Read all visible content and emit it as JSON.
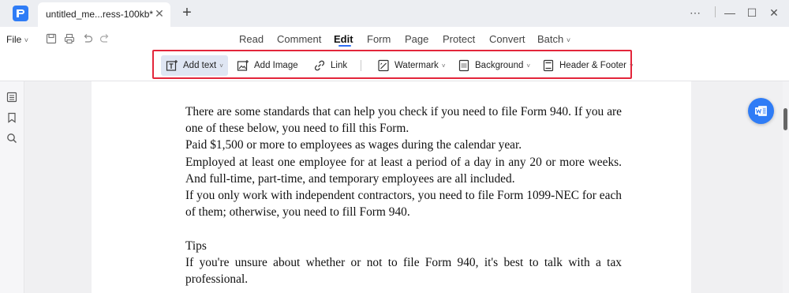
{
  "window": {
    "tab_title": "untitled_me...ress-100kb*",
    "tab_close": "✕",
    "new_tab": "+",
    "controls": {
      "more": "⋯",
      "minimize": "—",
      "maximize": "☐",
      "close": "✕"
    }
  },
  "menu": {
    "file_label": "File",
    "file_caret": "˅",
    "tabs": [
      {
        "label": "Read"
      },
      {
        "label": "Comment"
      },
      {
        "label": "Edit"
      },
      {
        "label": "Form"
      },
      {
        "label": "Page"
      },
      {
        "label": "Protect"
      },
      {
        "label": "Convert"
      },
      {
        "label": "Batch"
      }
    ],
    "batch_caret": "˅",
    "active_tab": "Edit"
  },
  "toolbar": {
    "add_text": "Add text",
    "add_image": "Add Image",
    "link": "Link",
    "watermark": "Watermark",
    "background": "Background",
    "header_footer": "Header & Footer",
    "caret": "˅"
  },
  "document": {
    "lines": [
      "There are some standards that can help you check if you need to file Form 940. If you are one of these below, you need to fill this Form.",
      "Paid $1,500 or more to employees as wages during the calendar year.",
      "Employed at least one employee for at least a period of a day in any 20 or more weeks. And full-time, part-time, and temporary employees are all included.",
      "If you only work with independent contractors, you need to file Form 1099-NEC for each of them; otherwise, you need to fill Form 940."
    ],
    "tips_heading": "Tips",
    "tips_text": "If you're unsure about whether or not to file Form 940, it's best to talk with a tax professional."
  },
  "colors": {
    "accent": "#2f7cf6",
    "highlight_border": "#e3263b",
    "active_tool_bg": "#dfe6f3"
  },
  "icons": {
    "app_logo": "pdf-app-logo",
    "save": "save-icon",
    "print": "print-icon",
    "undo": "undo-icon",
    "redo": "redo-icon",
    "thumbnails": "page-thumbnails-icon",
    "bookmark": "bookmark-icon",
    "search": "search-icon",
    "word": "word-convert-icon"
  }
}
